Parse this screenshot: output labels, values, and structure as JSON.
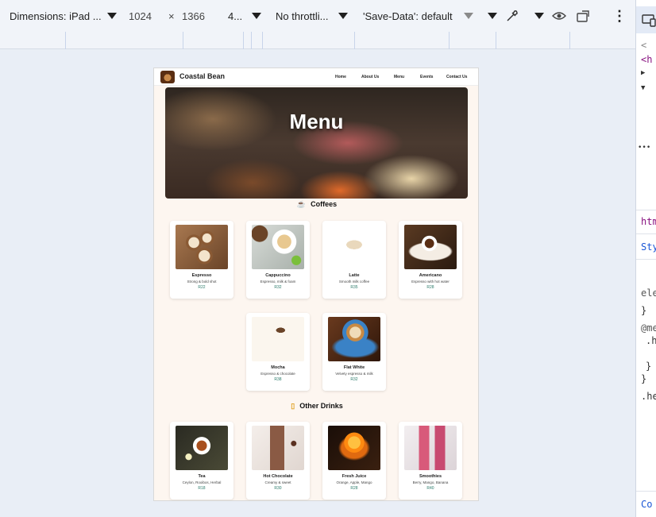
{
  "toolbar": {
    "dimensions": "Dimensions: iPad ...",
    "width": "1024",
    "times": "×",
    "height": "1366",
    "zoom": "4...",
    "throttling": "No throttli...",
    "save_data": "'Save-Data': default"
  },
  "devtools": {
    "line1": "<",
    "line2": "<h",
    "line3": "▶",
    "line4": "▼",
    "line5": "•••",
    "tab_html": "htm",
    "tab_styles": "Sty",
    "line_ele": "ele",
    "brace1": "}",
    "media": "@me",
    "dot_h": ".h",
    "brace2": "}",
    "brace3": "}",
    "dot_he": ".he",
    "bottom": "Co"
  },
  "site": {
    "brand": "Coastal Bean",
    "nav": [
      "Home",
      "About Us",
      "Menu",
      "Events",
      "Contact Us"
    ],
    "hero_title": "Menu"
  },
  "sections": {
    "coffees": "Coffees",
    "other": "Other Drinks"
  },
  "coffees": [
    {
      "name": "Espresso",
      "desc": "Strong & bold shot",
      "price": "R22"
    },
    {
      "name": "Cappuccino",
      "desc": "Espresso, milk & foam",
      "price": "R32"
    },
    {
      "name": "Latte",
      "desc": "Smooth milk coffee",
      "price": "R35"
    },
    {
      "name": "Americano",
      "desc": "Espresso with hot water",
      "price": "R28"
    },
    {
      "name": "Mocha",
      "desc": "Espresso & chocolate",
      "price": "R38"
    },
    {
      "name": "Flat White",
      "desc": "Velvety espresso & milk",
      "price": "R32"
    }
  ],
  "other_drinks": [
    {
      "name": "Tea",
      "desc": "Ceylon, Rooibos, Herbal",
      "price": "R18"
    },
    {
      "name": "Hot Chocolate",
      "desc": "Creamy & sweet",
      "price": "R30"
    },
    {
      "name": "Fresh Juice",
      "desc": "Orange, Apple, Mango",
      "price": "R28"
    },
    {
      "name": "Smoothies",
      "desc": "Berry, Mango, Banana",
      "price": "R40"
    }
  ],
  "colors": {
    "page_bg": "#fdf6f0",
    "price": "#2a7a6a",
    "accent_icon": "#e0a020"
  }
}
